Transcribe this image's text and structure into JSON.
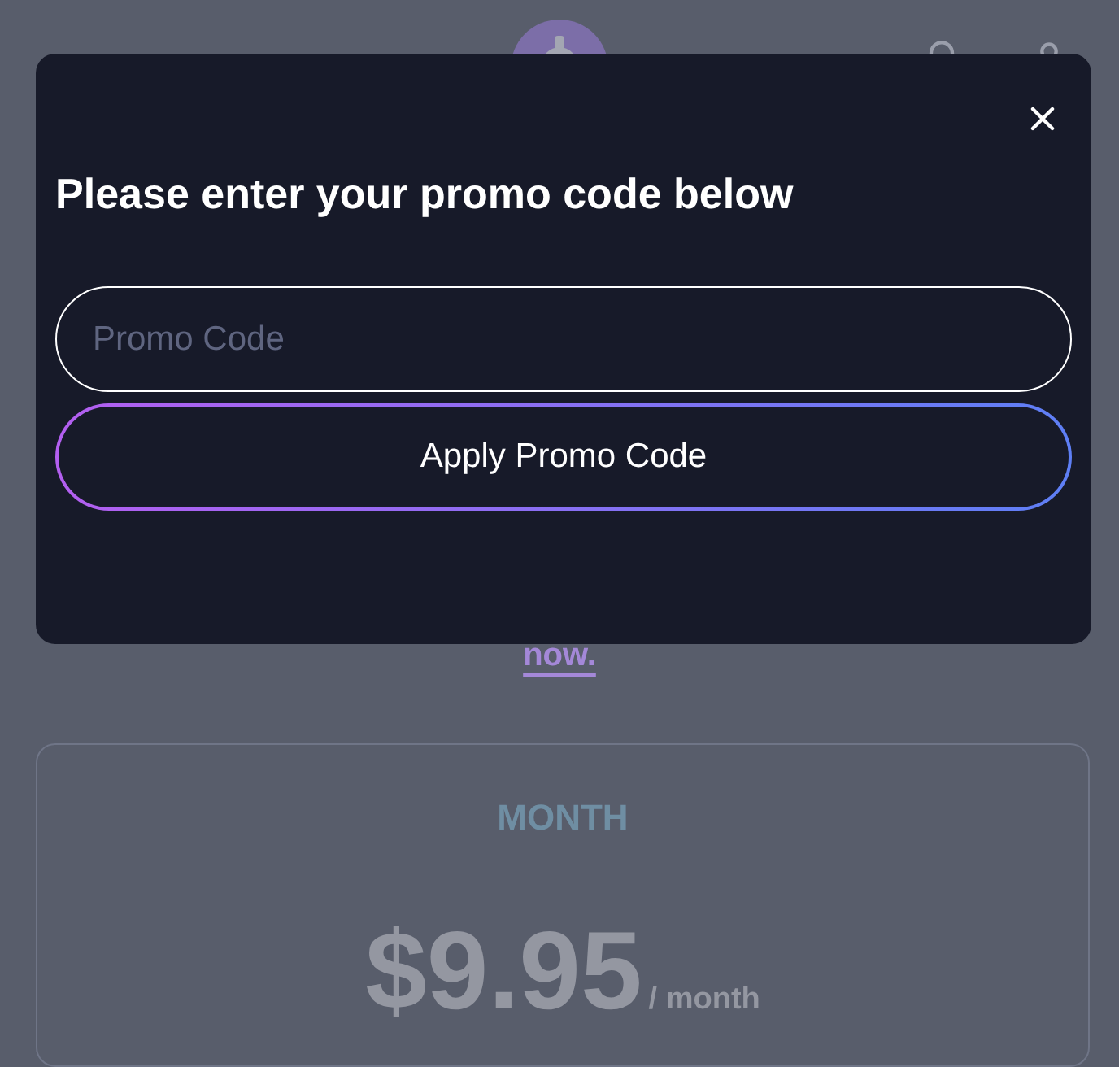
{
  "page": {
    "link": "now.",
    "plan": {
      "label": "MONTH",
      "price": "$9.95",
      "period": "/ month"
    }
  },
  "modal": {
    "title": "Please enter your promo code below",
    "input": {
      "placeholder": "Promo Code"
    },
    "button": "Apply Promo Code"
  }
}
